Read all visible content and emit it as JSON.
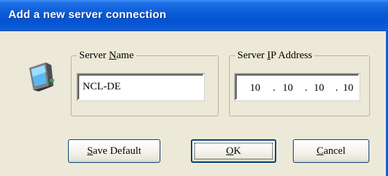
{
  "window": {
    "title": "Add a new server connection"
  },
  "icon": {
    "name": "server-computer-icon"
  },
  "server_name_group": {
    "legend_prefix": "Server ",
    "legend_accel": "N",
    "legend_suffix": "ame",
    "value": "NCL-DE"
  },
  "ip_group": {
    "legend_prefix": "Server ",
    "legend_accel": "I",
    "legend_suffix": "P Address",
    "octets": [
      "10",
      "10",
      "10",
      "10"
    ],
    "separator": "."
  },
  "buttons": {
    "save_accel": "S",
    "save_rest": "ave Default",
    "ok_accel": "O",
    "ok_rest": "K",
    "cancel_accel": "C",
    "cancel_rest": "ancel"
  },
  "colors": {
    "titlebar": "#0a5ad7",
    "dialog_bg": "#ece9d8",
    "button_border": "#003c74"
  }
}
